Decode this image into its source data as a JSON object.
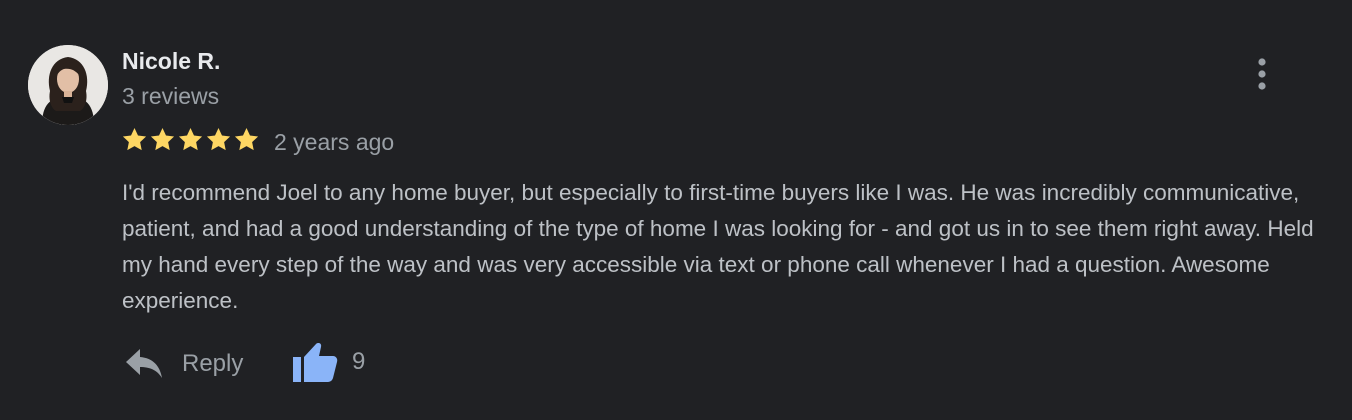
{
  "review": {
    "author_name": "Nicole R.",
    "review_count": "3 reviews",
    "rating": 5,
    "rating_max": 5,
    "date": "2 years ago",
    "text": "I'd recommend Joel to any home buyer, but especially to first-time buyers like I was. He was incredibly communicative, patient, and had a good understanding of the type of home I was looking for - and got us in to see them right away. Held my hand every step of the way and was very accessible via text or phone call whenever I had a question. Awesome experience.",
    "more_options_icon": "more-vert-icon"
  },
  "actions": {
    "reply_label": "Reply",
    "reply_icon": "reply-arrow-icon",
    "like_icon": "thumbs-up-icon",
    "like_count": "9"
  },
  "colors": {
    "background": "#202124",
    "star": "#fdd663",
    "like_icon": "#8ab4f8"
  }
}
